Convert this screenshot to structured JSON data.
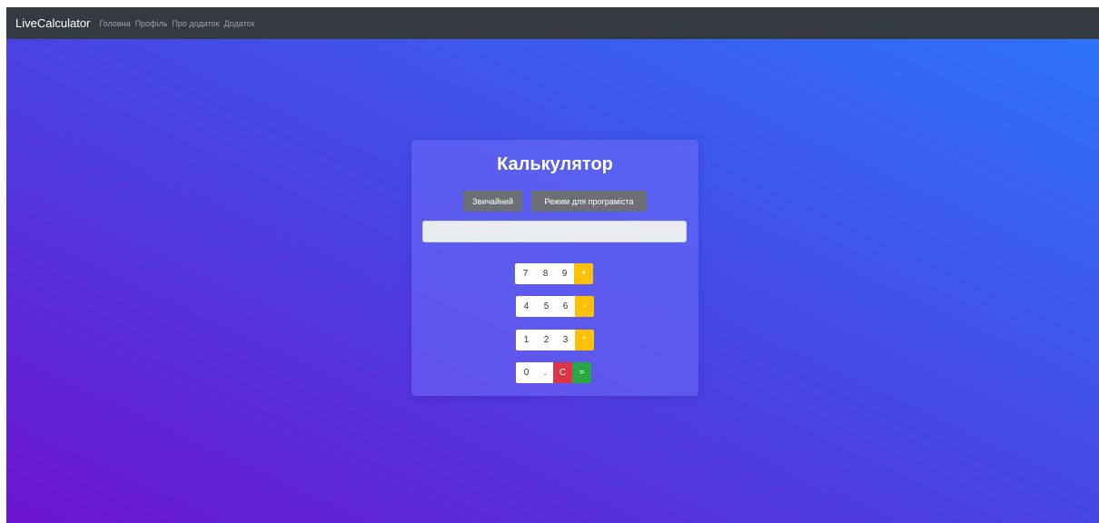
{
  "navbar": {
    "brand": "LiveCalculator",
    "links": [
      "Головна",
      "Профіль",
      "Про додаток",
      "Додаток"
    ]
  },
  "calculator": {
    "title": "Калькулятор",
    "modes": [
      "Звичайний",
      "Режим для програміста"
    ],
    "display_value": "",
    "rows": [
      [
        "7",
        "8",
        "9",
        "+"
      ],
      [
        "4",
        "5",
        "6",
        "-"
      ],
      [
        "1",
        "2",
        "3",
        "*"
      ],
      [
        "0",
        ".",
        "C",
        "="
      ]
    ]
  },
  "colors": {
    "navbar": "#343a40",
    "operator": "#ffc107",
    "clear": "#dc3545",
    "equals": "#28a745",
    "mode_button": "#6c6f74",
    "gradient_top_right": "#2c76f8",
    "gradient_bottom_left": "#6b14ce"
  }
}
